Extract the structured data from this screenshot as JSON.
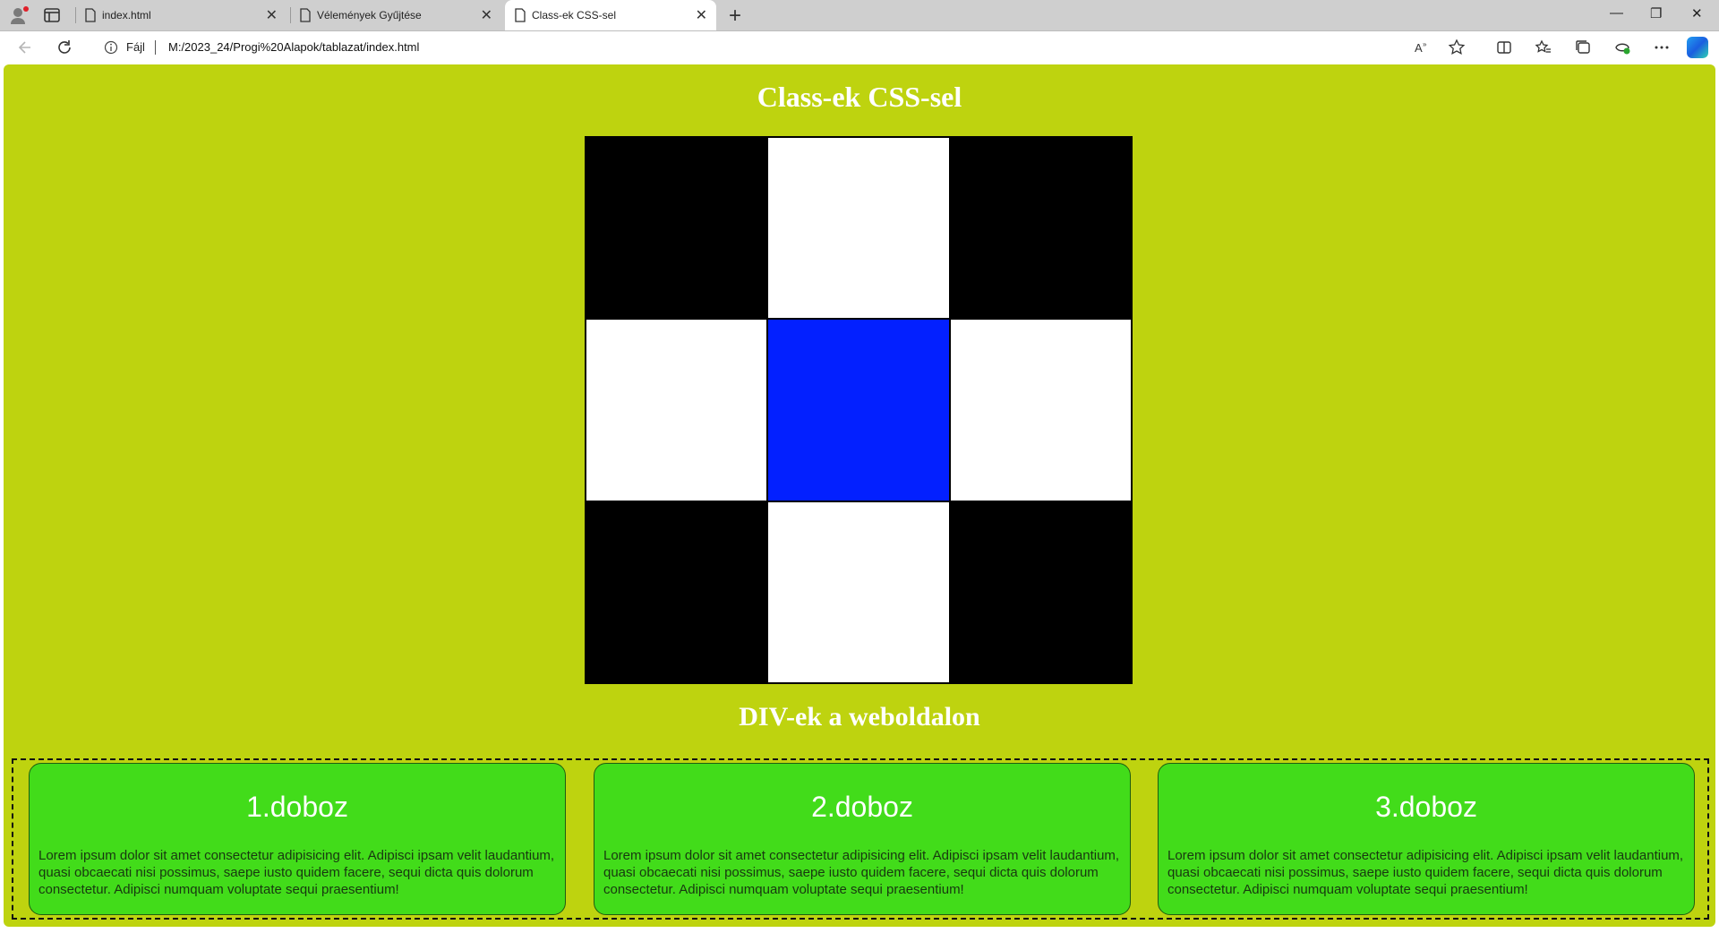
{
  "browser": {
    "tabs": [
      {
        "title": "index.html",
        "active": false
      },
      {
        "title": "Vélemények Gyűjtése",
        "active": false
      },
      {
        "title": "Class-ek CSS-sel",
        "active": true
      }
    ],
    "address": {
      "scheme_label": "Fájl",
      "url": "M:/2023_24/Progi%20Alapok/tablazat/index.html"
    },
    "toolbar_icons": [
      "read-aloud-icon",
      "favorite-star-icon",
      "split-screen-icon",
      "favorites-icon",
      "collections-icon",
      "browser-essentials-icon",
      "more-icon",
      "copilot-icon"
    ]
  },
  "page": {
    "heading1": "Class-ek CSS-sel",
    "board": {
      "cells": [
        "black",
        "white",
        "black",
        "white",
        "blue",
        "white",
        "black",
        "white",
        "black"
      ],
      "colors": {
        "black": "#000000",
        "white": "#ffffff",
        "blue": "#0320ff"
      }
    },
    "heading2": "DIV-ek a weboldalon",
    "boxes": [
      {
        "title": "1.doboz",
        "text": "Lorem ipsum dolor sit amet consectetur adipisicing elit. Adipisci ipsam velit laudantium, quasi obcaecati nisi possimus, saepe iusto quidem facere, sequi dicta quis dolorum consectetur. Adipisci numquam voluptate sequi praesentium!"
      },
      {
        "title": "2.doboz",
        "text": "Lorem ipsum dolor sit amet consectetur adipisicing elit. Adipisci ipsam velit laudantium, quasi obcaecati nisi possimus, saepe iusto quidem facere, sequi dicta quis dolorum consectetur. Adipisci numquam voluptate sequi praesentium!"
      },
      {
        "title": "3.doboz",
        "text": "Lorem ipsum dolor sit amet consectetur adipisicing elit. Adipisci ipsam velit laudantium, quasi obcaecati nisi possimus, saepe iusto quidem facere, sequi dicta quis dolorum consectetur. Adipisci numquam voluptate sequi praesentium!"
      }
    ],
    "colors": {
      "background": "#bed30f",
      "box": "#42dc1a",
      "heading": "#ffffff"
    }
  }
}
